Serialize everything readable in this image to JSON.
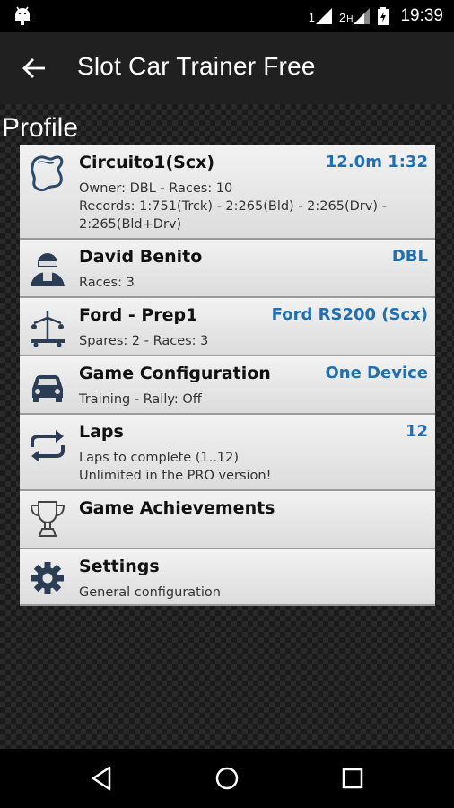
{
  "status_bar": {
    "sim1": "1",
    "sim2": "2",
    "sim2_badge": "H",
    "time": "19:39"
  },
  "app_bar": {
    "title": "Slot Car Trainer Free",
    "back_icon": "arrow-back-icon"
  },
  "section_title": "Profile",
  "items": [
    {
      "icon": "track-icon",
      "name": "Circuito1(Scx)",
      "value": "12.0m 1:32",
      "sub": [
        "Owner: DBL - Races: 10",
        "Records: 1:751(Trck) - 2:265(Bld) - 2:265(Drv) -",
        "2:265(Bld+Drv)"
      ]
    },
    {
      "icon": "driver-icon",
      "name": "David Benito",
      "value": "DBL",
      "sub": [
        "Races: 3"
      ]
    },
    {
      "icon": "car-parts-icon",
      "name": "Ford - Prep1",
      "value": "Ford RS200 (Scx)",
      "sub": [
        "Spares: 2 - Races: 3"
      ]
    },
    {
      "icon": "car-icon",
      "name": "Game Configuration",
      "value": "One Device",
      "sub": [
        "Training - Rally: Off"
      ]
    },
    {
      "icon": "repeat-icon",
      "name": "Laps",
      "value": "12",
      "sub": [
        "Laps to complete (1..12)",
        "Unlimited in the PRO version!"
      ]
    },
    {
      "icon": "trophy-icon",
      "name": "Game Achievements",
      "value": "",
      "sub": []
    },
    {
      "icon": "gear-icon",
      "name": "Settings",
      "value": "",
      "sub": [
        "General configuration"
      ]
    }
  ],
  "nav_bar": {
    "back": "nav-back-icon",
    "home": "nav-home-icon",
    "recents": "nav-recents-icon"
  }
}
